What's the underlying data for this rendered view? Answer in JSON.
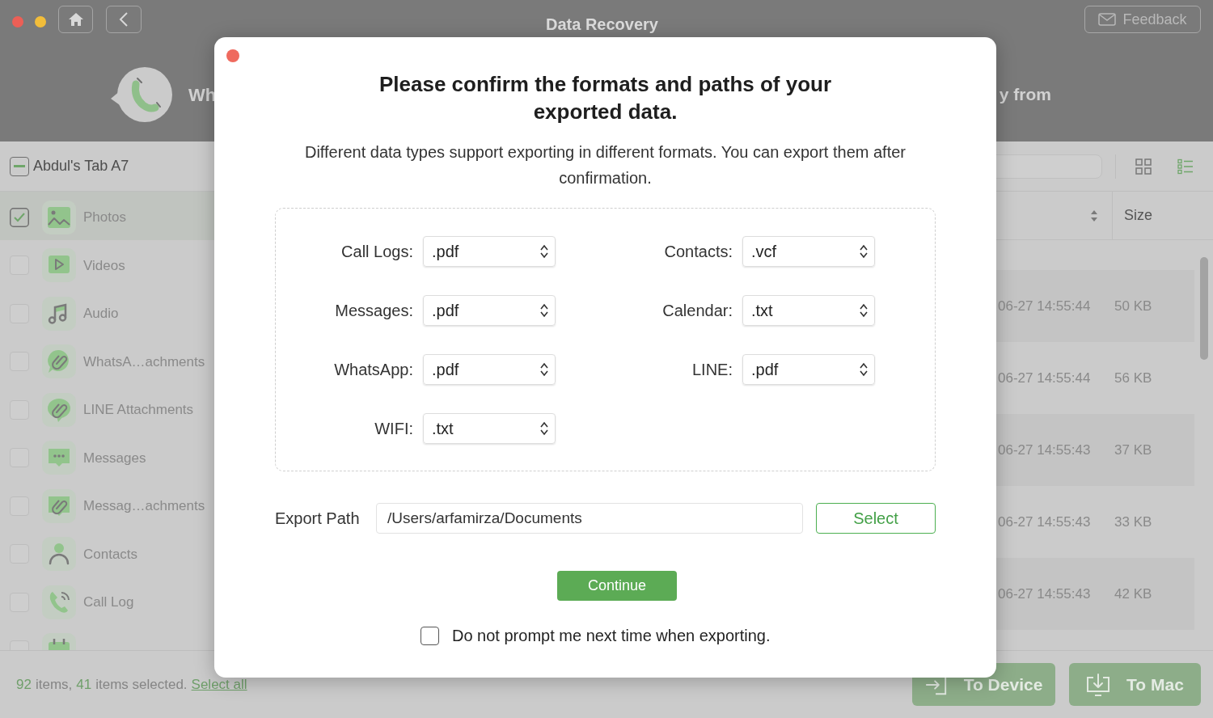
{
  "window": {
    "title": "Data Recovery",
    "feedback_button": "Feedback"
  },
  "header": {
    "title_start": "Wh",
    "title_end": "y from"
  },
  "device": {
    "name": "Abdul's Tab A7",
    "partially_checked": true
  },
  "sidebar": {
    "items": [
      {
        "kind": "photos",
        "label": "Photos",
        "checked": true,
        "selected": true
      },
      {
        "kind": "videos",
        "label": "Videos",
        "checked": false,
        "selected": false
      },
      {
        "kind": "audio",
        "label": "Audio",
        "checked": false,
        "selected": false
      },
      {
        "kind": "whatsapp_attachments",
        "label": "WhatsA…achments",
        "checked": false,
        "selected": false
      },
      {
        "kind": "line_attachments",
        "label": "LINE Attachments",
        "checked": false,
        "selected": false
      },
      {
        "kind": "messages",
        "label": "Messages",
        "checked": false,
        "selected": false
      },
      {
        "kind": "message_attachments",
        "label": "Messag…achments",
        "checked": false,
        "selected": false
      },
      {
        "kind": "contacts",
        "label": "Contacts",
        "checked": false,
        "selected": false
      },
      {
        "kind": "call_log",
        "label": "Call Log",
        "checked": false,
        "selected": false
      },
      {
        "kind": "calendar",
        "checked": false,
        "selected": false
      }
    ]
  },
  "view_modes": [
    {
      "kind": "grid",
      "selected": false
    },
    {
      "kind": "list",
      "selected": true
    }
  ],
  "table": {
    "size_column": "Size",
    "rows": [
      {
        "column_1": "06-27 14:55:44",
        "size": "50 KB"
      },
      {
        "column_1": "06-27 14:55:44",
        "size": "56 KB"
      },
      {
        "column_1": "06-27 14:55:43",
        "size": "37 KB"
      },
      {
        "column_1": "06-27 14:55:43",
        "size": "33 KB"
      },
      {
        "column_1": "06-27 14:55:43",
        "size": "42 KB"
      }
    ]
  },
  "status_bar": {
    "item_count": "92",
    "items_label": "items,",
    "selected_count": "41",
    "selected_label": "items selected.",
    "select_all_link": "Select all"
  },
  "actions": [
    {
      "kind": "to_device",
      "label": "To Device"
    },
    {
      "kind": "to_mac",
      "label": "To Mac"
    }
  ],
  "dialog": {
    "title": "Please confirm the formats and paths of your exported data.",
    "description": "Different data types support exporting in different formats. You can export them after confirmation.",
    "formats": [
      {
        "label": "Call Logs:",
        "value": ".pdf"
      },
      {
        "label": "Contacts:",
        "value": ".vcf"
      },
      {
        "label": "Messages:",
        "value": ".pdf"
      },
      {
        "label": "Calendar:",
        "value": ".txt"
      },
      {
        "label": "WhatsApp:",
        "value": ".pdf"
      },
      {
        "label": "LINE:",
        "value": ".pdf"
      },
      {
        "label": "WIFI:",
        "value": ".txt"
      }
    ],
    "export_path": {
      "label": "Export Path",
      "value": "/Users/arfamirza/Documents"
    },
    "select_button": "Select",
    "continue_button": "Continue",
    "dont_prompt": {
      "label": "Do not prompt me next time when exporting.",
      "checked": false
    }
  }
}
